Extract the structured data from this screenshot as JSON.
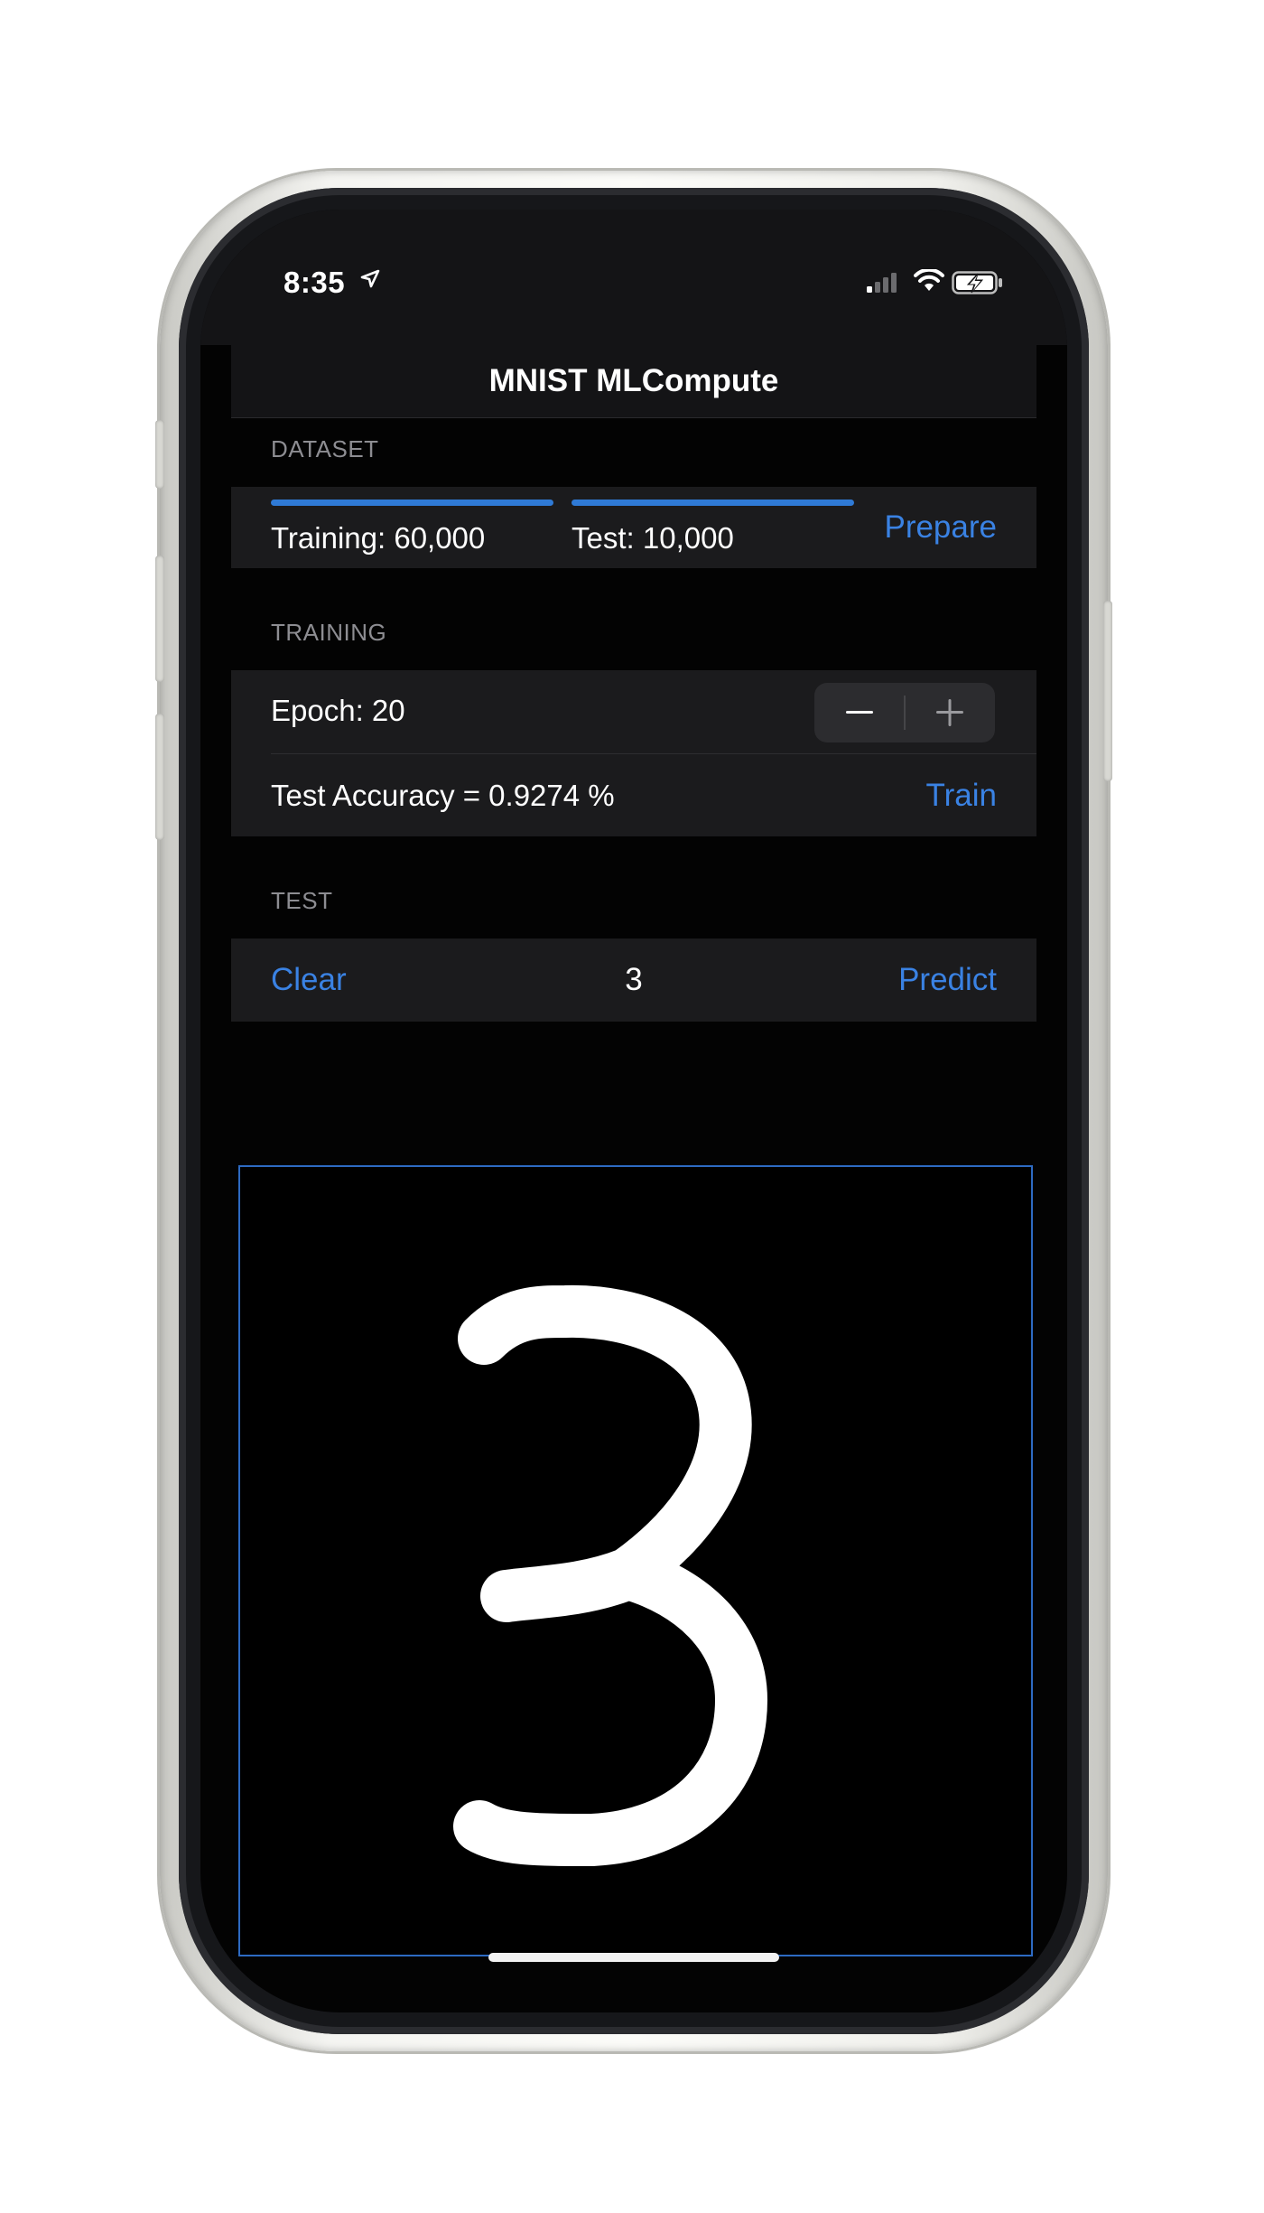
{
  "status_bar": {
    "time": "8:35",
    "icons": [
      "location-arrow-icon",
      "cellular-signal-icon",
      "wifi-icon",
      "battery-charging-icon"
    ]
  },
  "nav": {
    "title": "MNIST MLCompute"
  },
  "dataset": {
    "header": "DATASET",
    "training_label": "Training: 60,000",
    "training_progress": 1.0,
    "test_label": "Test: 10,000",
    "test_progress": 1.0,
    "prepare_button": "Prepare"
  },
  "training": {
    "header": "TRAINING",
    "epoch_label": "Epoch:  20",
    "accuracy_label": "Test Accuracy = 0.9274 %",
    "train_button": "Train",
    "stepper": {
      "minus": "decrement",
      "plus": "increment"
    }
  },
  "test": {
    "header": "TEST",
    "clear_button": "Clear",
    "prediction": "3",
    "predict_button": "Predict"
  },
  "drawing_canvas": {
    "drawn_digit": "3"
  },
  "colors": {
    "accent": "#3a82e3",
    "background": "#030303",
    "group_background": "#1b1b1d",
    "secondary_text": "#8d8d92",
    "canvas_border": "#2d6ac2"
  }
}
